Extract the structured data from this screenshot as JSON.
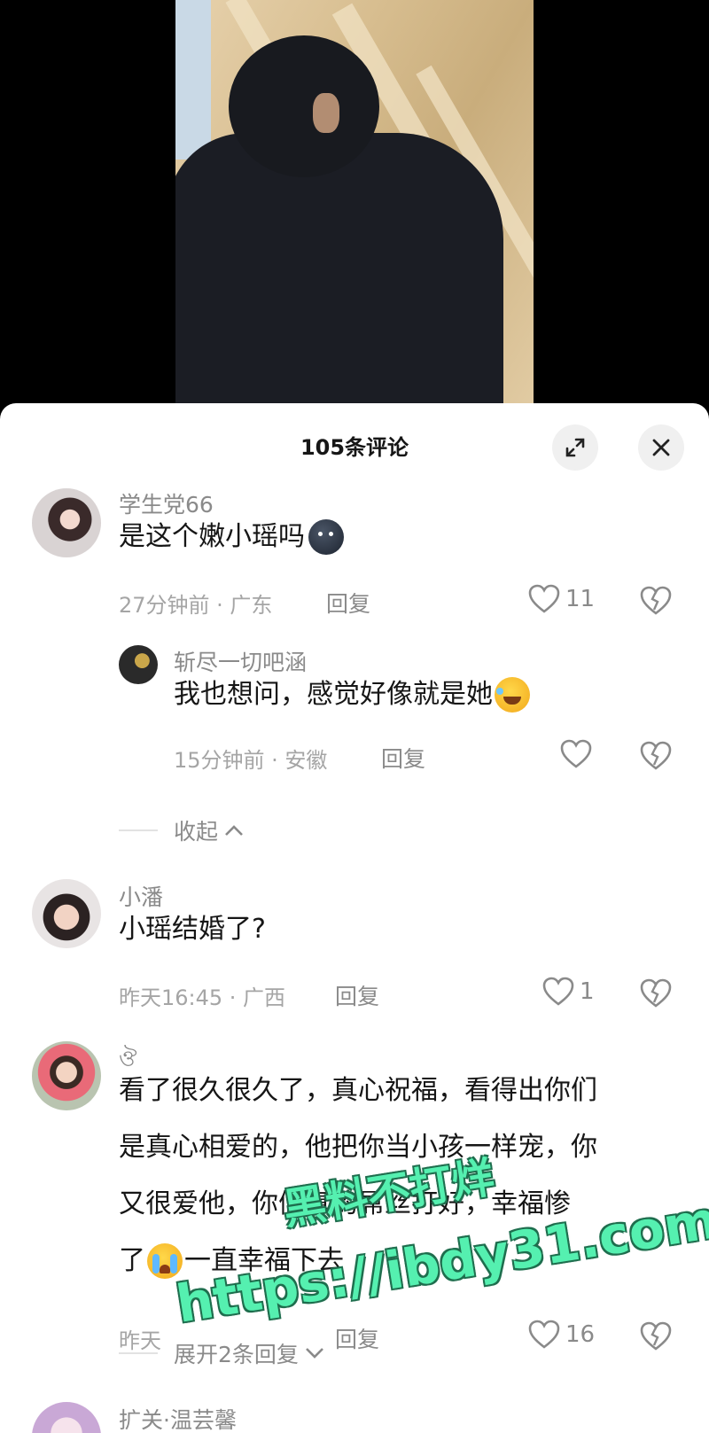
{
  "header": {
    "title": "105条评论"
  },
  "icons": {
    "expand": "expand-icon",
    "close": "close-icon",
    "like": "heart-outline-icon",
    "dislike": "broken-heart-icon",
    "collapse": "chevron-up-icon",
    "more": "chevron-down-icon"
  },
  "comments": [
    {
      "username": "学生党66",
      "text": "是这个嫩小瑶吗",
      "meta": "27分钟前 · 广东",
      "reply_label": "回复",
      "likes": "11",
      "emoji": "round-face-emoji",
      "replies": [
        {
          "username": "斩尽一切吧涵",
          "text": "我也想问，感觉好像就是她",
          "meta": "15分钟前 · 安徽",
          "reply_label": "回复",
          "likes": "",
          "emoji": "laughing-emoji"
        }
      ],
      "thread_toggle": "收起"
    },
    {
      "username": "小潘",
      "text": "小瑶结婚了?",
      "meta": "昨天16:45 · 广西",
      "reply_label": "回复",
      "likes": "1"
    },
    {
      "username": "ঔ",
      "text_lines": [
        "看了很久很久了，真心祝福，看得出你们",
        "是真心相爱的，他把你当小孩一样宠，你",
        "又很爱他，你们真的屌丝打好，幸福惨",
        "了一直幸福下去"
      ],
      "emoji": "crying-emoji",
      "meta": "昨天",
      "reply_label": "回复",
      "likes": "16",
      "thread_toggle": "展开2条回复"
    },
    {
      "username": "扩关·温芸馨"
    }
  ],
  "watermark": {
    "line1": "黑料不打烊",
    "line2": "https://ibdy31.com",
    "color": "#55f0b0"
  }
}
